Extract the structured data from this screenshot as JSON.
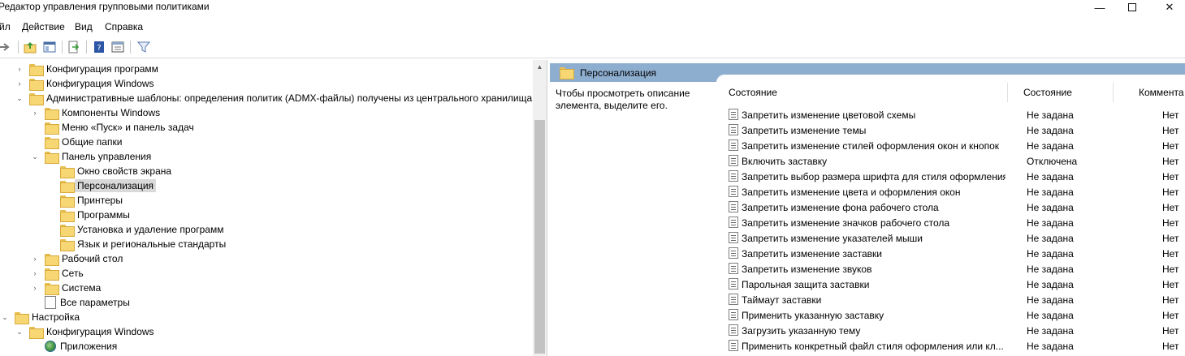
{
  "window": {
    "title": "Редактор управления групповыми политиками",
    "min_glyph": "—",
    "close_glyph": "✕"
  },
  "menu": [
    "йл",
    "Действие",
    "Вид",
    "Справка"
  ],
  "toolbar": [
    "back-arrow-icon",
    "up-folder-icon",
    "show-hide-tree-icon",
    "export-list-icon",
    "help-icon",
    "properties-icon",
    "filter-icon"
  ],
  "tree": [
    {
      "label": "Конфигурация программ",
      "arrow": "›",
      "icon": "folder"
    },
    {
      "label": "Конфигурация Windows",
      "arrow": "›",
      "icon": "folder"
    },
    {
      "label": "Административные шаблоны: определения политик (ADMX-файлы) получены из центрального хранилища",
      "arrow": "⌄",
      "icon": "folder"
    },
    {
      "label": "Компоненты Windows",
      "arrow": "›",
      "icon": "folder"
    },
    {
      "label": "Меню «Пуск» и панель задач",
      "arrow": "",
      "icon": "folder"
    },
    {
      "label": "Общие папки",
      "arrow": "",
      "icon": "folder"
    },
    {
      "label": "Панель управления",
      "arrow": "⌄",
      "icon": "folder"
    },
    {
      "label": "Окно свойств экрана",
      "arrow": "",
      "icon": "folder"
    },
    {
      "label": "Персонализация",
      "arrow": "",
      "icon": "folder",
      "selected": true
    },
    {
      "label": "Принтеры",
      "arrow": "",
      "icon": "folder"
    },
    {
      "label": "Программы",
      "arrow": "",
      "icon": "folder"
    },
    {
      "label": "Установка и удаление программ",
      "arrow": "",
      "icon": "folder"
    },
    {
      "label": "Язык и региональные стандарты",
      "arrow": "",
      "icon": "folder"
    },
    {
      "label": "Рабочий стол",
      "arrow": "›",
      "icon": "folder"
    },
    {
      "label": "Сеть",
      "arrow": "›",
      "icon": "folder"
    },
    {
      "label": "Система",
      "arrow": "›",
      "icon": "folder"
    },
    {
      "label": "Все параметры",
      "arrow": "",
      "icon": "doc"
    },
    {
      "label": "Настройка",
      "arrow": "⌄",
      "icon": "folder"
    },
    {
      "label": "Конфигурация Windows",
      "arrow": "⌄",
      "icon": "folder"
    },
    {
      "label": "Приложения",
      "arrow": "",
      "icon": "globe"
    }
  ],
  "scroll_up_glyph": "▲",
  "right": {
    "header": "Персонализация",
    "description": "Чтобы просмотреть описание элемента, выделите его.",
    "columns": {
      "name": "Состояние",
      "state": "Состояние",
      "comment": "Коммента"
    },
    "rows": [
      {
        "name": "Запретить изменение цветовой схемы",
        "state": "Не задана",
        "comment": "Нет"
      },
      {
        "name": "Запретить изменение темы",
        "state": "Не задана",
        "comment": "Нет"
      },
      {
        "name": "Запретить изменение стилей оформления окон и кнопок",
        "state": "Не задана",
        "comment": "Нет"
      },
      {
        "name": "Включить заставку",
        "state": "Отключена",
        "comment": "Нет"
      },
      {
        "name": "Запретить выбор размера шрифта для стиля оформления",
        "state": "Не задана",
        "comment": "Нет"
      },
      {
        "name": "Запретить изменение цвета и оформления окон",
        "state": "Не задана",
        "comment": "Нет"
      },
      {
        "name": "Запретить изменение фона рабочего стола",
        "state": "Не задана",
        "comment": "Нет"
      },
      {
        "name": "Запретить изменение значков рабочего стола",
        "state": "Не задана",
        "comment": "Нет"
      },
      {
        "name": "Запретить изменение указателей мыши",
        "state": "Не задана",
        "comment": "Нет"
      },
      {
        "name": "Запретить изменение заставки",
        "state": "Не задана",
        "comment": "Нет"
      },
      {
        "name": "Запретить изменение звуков",
        "state": "Не задана",
        "comment": "Нет"
      },
      {
        "name": "Парольная защита заставки",
        "state": "Не задана",
        "comment": "Нет"
      },
      {
        "name": "Таймаут заставки",
        "state": "Не задана",
        "comment": "Нет"
      },
      {
        "name": "Применить указанную заставку",
        "state": "Не задана",
        "comment": "Нет"
      },
      {
        "name": "Загрузить указанную тему",
        "state": "Не задана",
        "comment": "Нет"
      },
      {
        "name": "Применить конкретный файл стиля оформления или кл...",
        "state": "Не задана",
        "comment": "Нет"
      }
    ]
  }
}
